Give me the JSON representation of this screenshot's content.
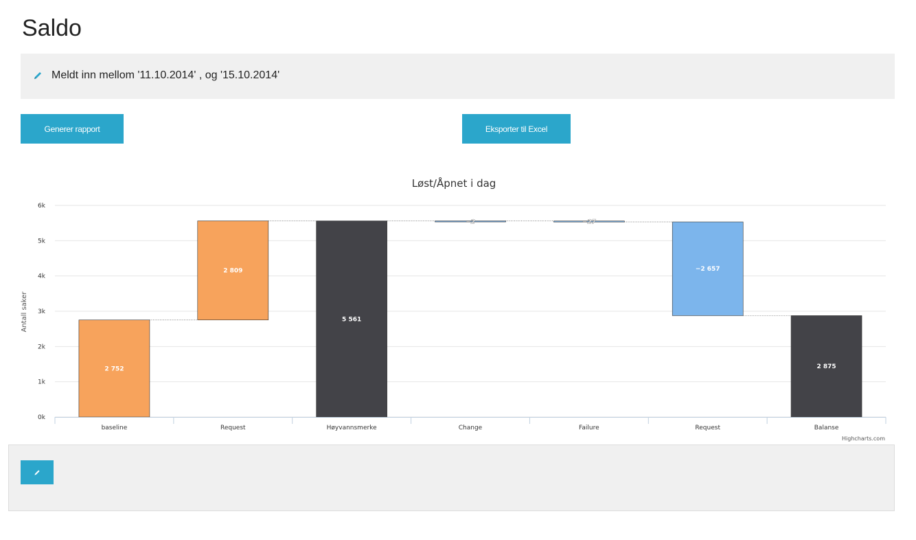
{
  "page": {
    "title": "Saldo"
  },
  "filter": {
    "text": "Meldt inn mellom '11.10.2014' , og '15.10.2014'",
    "icon": "pencil-icon"
  },
  "buttons": {
    "generate": "Generer rapport",
    "export": "Eksporter til Excel"
  },
  "colors": {
    "accent": "#2ba6cb",
    "increase": "#f7a35c",
    "decrease": "#7cb5ec",
    "sum": "#434348"
  },
  "chart_data": {
    "type": "bar",
    "subtype": "waterfall",
    "title": "Løst/Åpnet i dag",
    "ylabel": "Antall saker",
    "xlabel": "",
    "ylim": [
      0,
      6000
    ],
    "yticks": [
      "0k",
      "1k",
      "2k",
      "3k",
      "4k",
      "5k",
      "6k"
    ],
    "categories": [
      "baseline",
      "Request",
      "Høyvannsmerke",
      "Change",
      "Failure",
      "Request",
      "Balanse"
    ],
    "values": [
      2752,
      2809,
      5561,
      -2,
      -27,
      -2657,
      2875
    ],
    "kinds": [
      "increase",
      "increase",
      "sum",
      "decrease",
      "decrease",
      "decrease",
      "sum"
    ],
    "labels": [
      "2 752",
      "2 809",
      "5 561",
      "−2",
      "−27",
      "−2 657",
      "2 875"
    ],
    "credits": "Highcharts.com",
    "grid": true,
    "legend": "none"
  }
}
